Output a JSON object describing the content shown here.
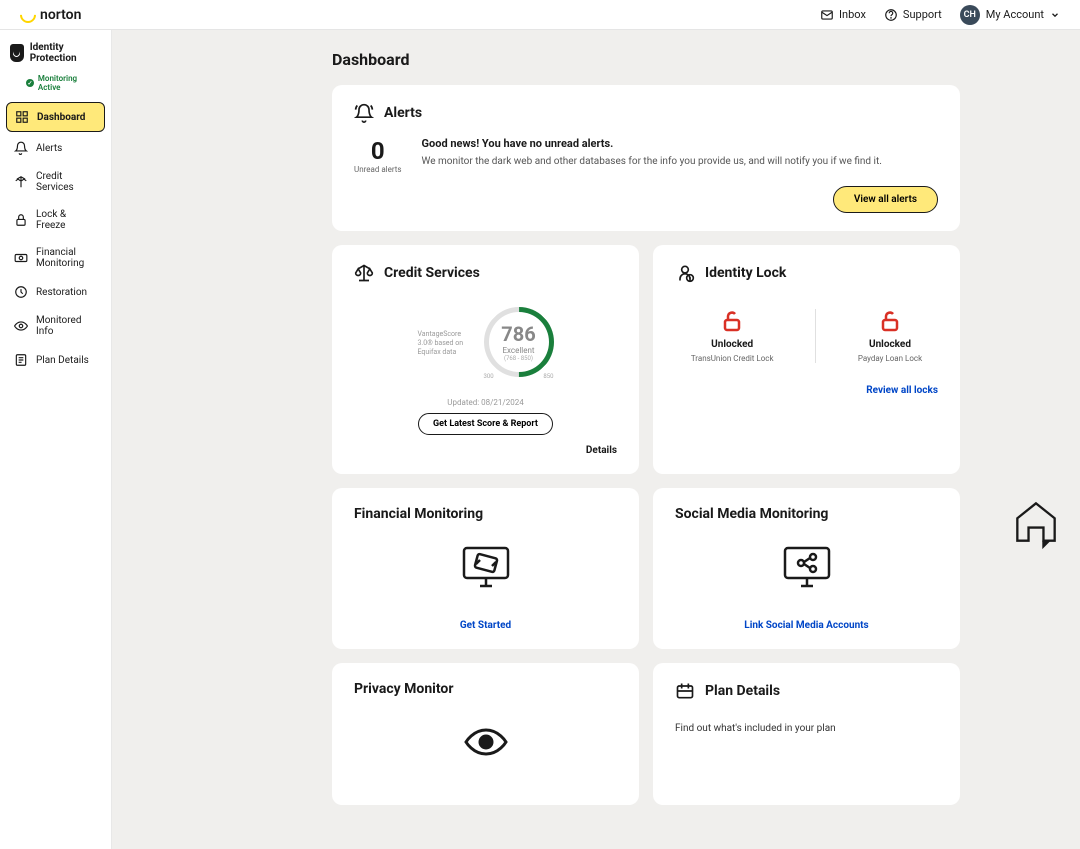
{
  "topbar": {
    "brand": "norton",
    "inbox": "Inbox",
    "support": "Support",
    "avatar_initials": "CH",
    "account_label": "My Account"
  },
  "sidebar": {
    "title": "Identity Protection",
    "monitoring_status": "Monitoring Active",
    "items": [
      {
        "label": "Dashboard"
      },
      {
        "label": "Alerts"
      },
      {
        "label": "Credit Services"
      },
      {
        "label": "Lock & Freeze"
      },
      {
        "label": "Financial Monitoring"
      },
      {
        "label": "Restoration"
      },
      {
        "label": "Monitored Info"
      },
      {
        "label": "Plan Details"
      }
    ]
  },
  "page": {
    "title": "Dashboard"
  },
  "alerts": {
    "title": "Alerts",
    "count": "0",
    "count_label": "Unread alerts",
    "headline": "Good news! You have no unread alerts.",
    "description": "We monitor the dark web and other databases for the info you provide us, and will notify you if we find it.",
    "button": "View all alerts"
  },
  "credit": {
    "title": "Credit Services",
    "note": "VantageScore 3.0® based on Equifax data",
    "score": "786",
    "rating": "Excellent",
    "range": "(768 - 850)",
    "min": "300",
    "max": "850",
    "updated": "Updated: 08/21/2024",
    "button": "Get Latest Score & Report",
    "link": "Details"
  },
  "identity_lock": {
    "title": "Identity Lock",
    "locks": [
      {
        "status": "Unlocked",
        "name": "TransUnion Credit Lock"
      },
      {
        "status": "Unlocked",
        "name": "Payday Loan Lock"
      }
    ],
    "link": "Review all locks"
  },
  "financial": {
    "title": "Financial Monitoring",
    "link": "Get Started"
  },
  "social": {
    "title": "Social Media Monitoring",
    "link": "Link Social Media Accounts"
  },
  "privacy": {
    "title": "Privacy Monitor"
  },
  "plan": {
    "title": "Plan Details",
    "description": "Find out what's included in your plan"
  }
}
